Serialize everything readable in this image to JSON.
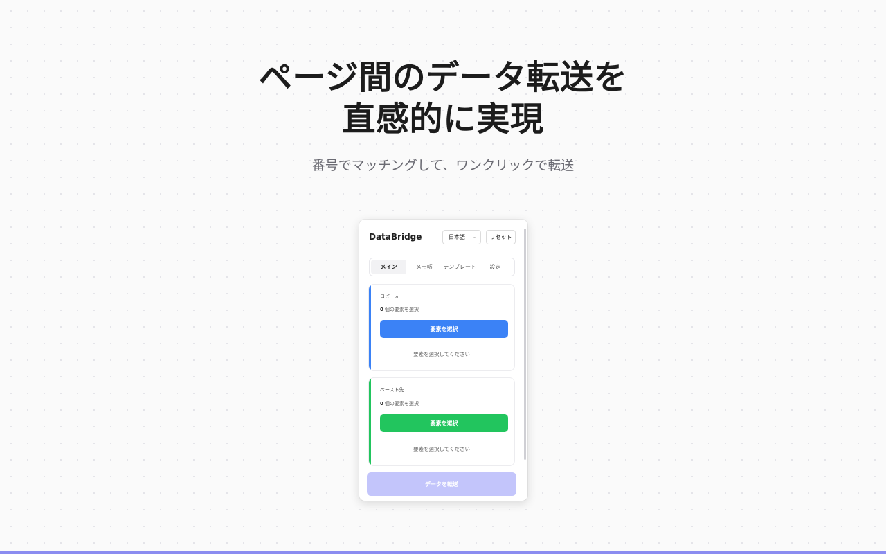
{
  "hero": {
    "title_line1": "ページ間のデータ転送を",
    "title_line2": "直感的に実現",
    "subtitle": "番号でマッチングして、ワンクリックで転送"
  },
  "popup": {
    "brand": "DataBridge",
    "language_selected": "日本語",
    "reset_label": "リセット",
    "tabs": [
      {
        "label": "メイン",
        "active": true
      },
      {
        "label": "メモ帳",
        "active": false
      },
      {
        "label": "テンプレート",
        "active": false
      },
      {
        "label": "設定",
        "active": false
      }
    ],
    "source": {
      "label": "コピー元",
      "count": "0",
      "count_suffix": "個の要素を選択",
      "button": "要素を選択",
      "hint": "要素を選択してください"
    },
    "target": {
      "label": "ペースト先",
      "count": "0",
      "count_suffix": "個の要素を選択",
      "button": "要素を選択",
      "hint": "要素を選択してください"
    },
    "transfer_button": "データを転送"
  },
  "colors": {
    "source_accent": "#3b82f6",
    "target_accent": "#22c55e",
    "transfer_disabled": "#c3c5fb",
    "bottom_strip": "#8b8cf0"
  },
  "icons": {
    "language_dropdown": "chevron-down-icon"
  }
}
